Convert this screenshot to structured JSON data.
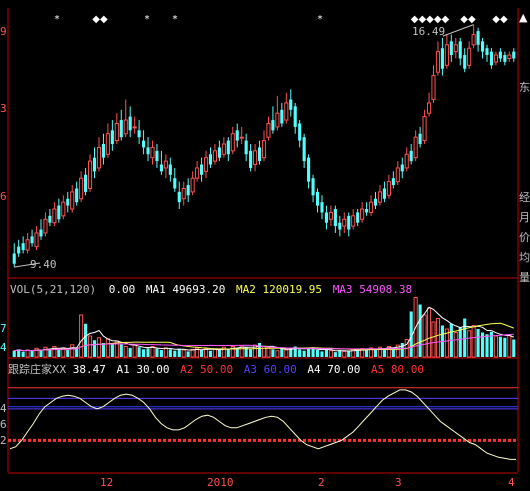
{
  "colors": {
    "background": "#000000",
    "up": "#ff5050",
    "down": "#54fcfc",
    "frame": "#c00000",
    "text": "#c0c0c0",
    "star": "#ffffff",
    "ma1": "#ffffff",
    "ma2": "#ffff54",
    "ma3": "#ff54ff",
    "a1": "#ffffff",
    "a2": "#ff3030",
    "a3": "#5a3cff",
    "a4": "#ffffff",
    "a5": "#ff3030"
  },
  "price_panel": {
    "axis_labels": [
      "9",
      "3",
      "6"
    ],
    "peak_label": "16.49",
    "low_label": "9.40",
    "markers": [
      "*",
      "◆◆",
      "*",
      "*",
      "*",
      "◆◆◆◆◆",
      "◆◆",
      "◆◆"
    ],
    "side_chars": [
      "▲",
      "东",
      "经",
      "月",
      "价",
      "均",
      "量"
    ]
  },
  "volume_panel": {
    "title": "VOL(5,21,120)",
    "vol_value": "0.00",
    "ma1_label": "MA1",
    "ma1_value": "49693.20",
    "ma2_label": "MA2",
    "ma2_value": "120019.95",
    "ma3_label": "MA3",
    "ma3_value": "54908.38",
    "axis_labels": [
      "7",
      "4"
    ]
  },
  "indicator_panel": {
    "name": "跟踪庄家X",
    "x_value": "38.47",
    "a1_label": "A1",
    "a1_value": "30.00",
    "a2_label": "A2",
    "a2_value": "50.00",
    "a3_label": "A3",
    "a3_value": "60.00",
    "a4_label": "A4",
    "a4_value": "70.00",
    "a5_label": "A5",
    "a5_value": "80.00",
    "axis_labels": [
      "4",
      "6",
      "2"
    ]
  },
  "x_axis": {
    "ticks": [
      "12",
      "2010",
      "2",
      "3",
      "4"
    ]
  },
  "chart_data": [
    {
      "type": "candlestick",
      "title": "",
      "annotations": [
        "16.49",
        "9.40"
      ],
      "ohlc": [
        [
          9.8,
          9.5,
          10.1,
          9.4
        ],
        [
          10.0,
          9.8,
          10.2,
          9.7
        ],
        [
          10.1,
          9.9,
          10.3,
          9.8
        ],
        [
          9.9,
          10.2,
          10.4,
          9.8
        ],
        [
          10.3,
          10.1,
          10.5,
          10.0
        ],
        [
          10.0,
          10.4,
          10.6,
          9.9
        ],
        [
          10.5,
          10.3,
          10.8,
          10.2
        ],
        [
          10.4,
          10.8,
          11.0,
          10.3
        ],
        [
          10.9,
          10.7,
          11.1,
          10.6
        ],
        [
          10.7,
          11.1,
          11.3,
          10.6
        ],
        [
          11.2,
          10.8,
          11.4,
          10.7
        ],
        [
          10.9,
          11.3,
          11.5,
          10.8
        ],
        [
          11.4,
          11.2,
          11.6,
          11.0
        ],
        [
          11.1,
          11.6,
          11.8,
          11.0
        ],
        [
          11.7,
          11.3,
          11.9,
          11.2
        ],
        [
          11.4,
          12.0,
          12.2,
          11.3
        ],
        [
          12.1,
          11.6,
          12.3,
          11.5
        ],
        [
          11.7,
          12.5,
          12.7,
          11.6
        ],
        [
          12.6,
          12.2,
          12.9,
          12.0
        ],
        [
          12.3,
          12.9,
          13.2,
          12.2
        ],
        [
          13.0,
          12.6,
          13.3,
          12.4
        ],
        [
          12.7,
          13.3,
          13.6,
          12.6
        ],
        [
          13.4,
          13.0,
          13.7,
          12.8
        ],
        [
          13.1,
          13.6,
          13.9,
          13.0
        ],
        [
          13.7,
          13.2,
          14.0,
          13.1
        ],
        [
          13.3,
          13.7,
          14.3,
          13.2
        ],
        [
          13.8,
          13.4,
          14.1,
          13.2
        ],
        [
          13.5,
          13.5,
          13.8,
          13.3
        ],
        [
          13.4,
          13.2,
          13.7,
          13.0
        ],
        [
          13.1,
          12.9,
          13.4,
          12.7
        ],
        [
          12.9,
          12.7,
          13.2,
          12.5
        ],
        [
          12.6,
          12.9,
          13.1,
          12.4
        ],
        [
          12.8,
          12.5,
          13.0,
          12.3
        ],
        [
          12.4,
          12.2,
          12.8,
          12.1
        ],
        [
          12.3,
          12.5,
          12.7,
          12.0
        ],
        [
          12.4,
          12.1,
          12.6,
          11.9
        ],
        [
          12.0,
          11.7,
          12.3,
          11.6
        ],
        [
          11.6,
          11.3,
          11.9,
          11.1
        ],
        [
          11.4,
          11.7,
          11.9,
          11.2
        ],
        [
          11.8,
          11.5,
          12.0,
          11.3
        ],
        [
          11.6,
          12.0,
          12.2,
          11.5
        ],
        [
          12.0,
          12.3,
          12.5,
          11.9
        ],
        [
          12.4,
          12.1,
          12.6,
          11.9
        ],
        [
          12.2,
          12.6,
          12.8,
          12.0
        ],
        [
          12.7,
          12.4,
          12.9,
          12.3
        ],
        [
          12.5,
          12.8,
          13.0,
          12.4
        ],
        [
          12.9,
          12.6,
          13.1,
          12.5
        ],
        [
          12.7,
          13.0,
          13.2,
          12.6
        ],
        [
          13.1,
          12.7,
          13.2,
          12.5
        ],
        [
          12.8,
          13.3,
          13.5,
          12.7
        ],
        [
          13.4,
          13.1,
          13.6,
          12.9
        ],
        [
          13.2,
          13.2,
          13.5,
          13.0
        ],
        [
          13.1,
          12.7,
          13.3,
          12.5
        ],
        [
          12.8,
          12.3,
          13.0,
          12.2
        ],
        [
          12.4,
          12.8,
          13.0,
          12.2
        ],
        [
          12.9,
          12.5,
          13.1,
          12.4
        ],
        [
          12.6,
          13.1,
          13.4,
          12.5
        ],
        [
          13.2,
          13.6,
          13.8,
          13.1
        ],
        [
          13.7,
          13.4,
          14.1,
          13.3
        ],
        [
          13.5,
          13.9,
          14.4,
          13.4
        ],
        [
          14.0,
          13.6,
          14.2,
          13.5
        ],
        [
          13.7,
          14.2,
          14.5,
          13.6
        ],
        [
          14.3,
          14.0,
          14.6,
          13.8
        ],
        [
          14.1,
          13.5,
          14.2,
          13.3
        ],
        [
          13.6,
          13.1,
          13.7,
          12.9
        ],
        [
          13.2,
          12.5,
          13.3,
          12.3
        ],
        [
          12.6,
          11.9,
          12.7,
          11.7
        ],
        [
          12.0,
          11.5,
          12.1,
          11.3
        ],
        [
          11.6,
          11.2,
          11.7,
          11.0
        ],
        [
          11.3,
          11.0,
          11.5,
          10.8
        ],
        [
          11.0,
          10.7,
          11.2,
          10.5
        ],
        [
          10.8,
          11.0,
          11.2,
          10.6
        ],
        [
          11.1,
          10.6,
          11.2,
          10.4
        ],
        [
          10.7,
          10.5,
          10.9,
          10.3
        ],
        [
          10.6,
          10.8,
          11.0,
          10.4
        ],
        [
          10.9,
          10.5,
          11.0,
          10.3
        ],
        [
          10.6,
          10.9,
          11.1,
          10.5
        ],
        [
          11.0,
          10.7,
          11.1,
          10.6
        ],
        [
          10.8,
          11.1,
          11.3,
          10.7
        ],
        [
          11.1,
          11.0,
          11.3,
          10.9
        ],
        [
          11.0,
          11.3,
          11.5,
          10.9
        ],
        [
          11.4,
          11.2,
          11.6,
          11.1
        ],
        [
          11.3,
          11.6,
          11.8,
          11.2
        ],
        [
          11.7,
          11.4,
          11.9,
          11.3
        ],
        [
          11.5,
          11.9,
          12.1,
          11.4
        ],
        [
          12.0,
          11.8,
          12.2,
          11.7
        ],
        [
          11.9,
          12.3,
          12.5,
          11.8
        ],
        [
          12.4,
          12.2,
          12.6,
          12.0
        ],
        [
          12.3,
          12.7,
          12.9,
          12.2
        ],
        [
          12.8,
          12.5,
          13.0,
          12.4
        ],
        [
          12.6,
          13.2,
          13.4,
          12.5
        ],
        [
          13.3,
          13.0,
          13.5,
          12.9
        ],
        [
          13.1,
          13.8,
          14.0,
          13.0
        ],
        [
          13.9,
          14.2,
          14.5,
          13.8
        ],
        [
          14.3,
          15.0,
          15.3,
          14.2
        ],
        [
          15.1,
          15.7,
          16.0,
          15.0
        ],
        [
          15.8,
          15.2,
          16.1,
          15.0
        ],
        [
          15.3,
          15.9,
          16.2,
          15.2
        ],
        [
          16.0,
          15.6,
          16.2,
          15.4
        ],
        [
          15.7,
          15.9,
          16.1,
          15.5
        ],
        [
          16.0,
          15.5,
          16.1,
          15.3
        ],
        [
          15.6,
          15.2,
          15.8,
          15.1
        ],
        [
          15.3,
          15.8,
          16.0,
          15.2
        ],
        [
          15.9,
          16.2,
          16.49,
          15.8
        ],
        [
          16.3,
          15.9,
          16.4,
          15.7
        ],
        [
          16.0,
          15.7,
          16.1,
          15.5
        ],
        [
          15.8,
          15.6,
          15.9,
          15.4
        ],
        [
          15.7,
          15.3,
          15.8,
          15.2
        ],
        [
          15.4,
          15.6,
          15.7,
          15.3
        ],
        [
          15.7,
          15.5,
          15.8,
          15.4
        ],
        [
          15.6,
          15.4,
          15.7,
          15.3
        ],
        [
          15.5,
          15.6,
          15.7,
          15.4
        ],
        [
          15.7,
          15.5,
          15.8,
          15.4
        ]
      ],
      "ylim": [
        9.2,
        16.8
      ]
    },
    {
      "type": "bar",
      "title": "VOL(5,21,120)",
      "series": [
        {
          "name": "MA1",
          "value": 49693.2
        },
        {
          "name": "MA2",
          "value": 120019.95
        },
        {
          "name": "MA3",
          "value": 54908.38
        }
      ],
      "values": [
        18,
        22,
        15,
        20,
        17,
        25,
        19,
        28,
        24,
        30,
        22,
        26,
        20,
        35,
        27,
        120,
        95,
        60,
        48,
        55,
        40,
        52,
        38,
        45,
        36,
        30,
        26,
        34,
        28,
        22,
        25,
        30,
        24,
        20,
        26,
        22,
        18,
        24,
        20,
        16,
        22,
        26,
        20,
        24,
        18,
        22,
        20,
        28,
        24,
        30,
        26,
        32,
        28,
        22,
        34,
        40,
        30,
        26,
        22,
        18,
        24,
        20,
        26,
        30,
        22,
        18,
        24,
        28,
        20,
        16,
        22,
        18,
        14,
        20,
        16,
        18,
        22,
        18,
        24,
        20,
        26,
        22,
        28,
        24,
        30,
        26,
        34,
        40,
        50,
        130,
        170,
        150,
        120,
        140,
        100,
        110,
        90,
        80,
        95,
        70,
        85,
        110,
        75,
        90,
        80,
        70,
        65,
        72,
        60,
        58,
        55,
        62,
        50
      ],
      "ylim": [
        0,
        180
      ]
    },
    {
      "type": "line",
      "title": "跟踪庄家X",
      "series": [
        {
          "name": "X",
          "values": [
            22,
            24,
            30,
            38,
            46,
            55,
            62,
            66,
            70,
            72,
            73,
            72,
            70,
            66,
            62,
            60,
            62,
            66,
            70,
            73,
            74,
            73,
            70,
            66,
            60,
            52,
            46,
            42,
            40,
            40,
            42,
            46,
            50,
            53,
            54,
            52,
            48,
            44,
            42,
            42,
            44,
            46,
            48,
            50,
            52,
            53,
            52,
            48,
            42,
            36,
            30,
            26,
            24,
            22,
            24,
            26,
            28,
            30,
            34,
            38,
            44,
            50,
            56,
            62,
            68,
            72,
            75,
            78,
            78,
            76,
            72,
            66,
            60,
            54,
            48,
            44,
            40,
            36,
            32,
            28,
            26,
            22,
            18,
            16,
            14,
            13,
            12,
            12
          ]
        },
        {
          "name": "A1",
          "value": 30.0
        },
        {
          "name": "A2",
          "value": 50.0
        },
        {
          "name": "A3",
          "value": 60.0
        },
        {
          "name": "A4",
          "value": 70.0
        },
        {
          "name": "A5",
          "value": 80.0
        }
      ],
      "ylim": [
        0,
        95
      ]
    }
  ]
}
